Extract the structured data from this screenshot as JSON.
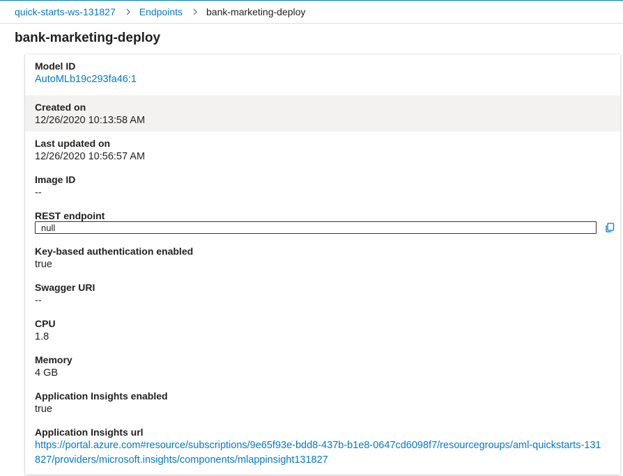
{
  "breadcrumb": {
    "items": [
      "quick-starts-ws-131827",
      "Endpoints"
    ],
    "current": "bank-marketing-deploy"
  },
  "page": {
    "title": "bank-marketing-deploy"
  },
  "details": {
    "model_id": {
      "label": "Model ID",
      "value": "AutoMLb19c293fa46:1"
    },
    "created_on": {
      "label": "Created on",
      "value": "12/26/2020 10:13:58 AM"
    },
    "last_updated": {
      "label": "Last updated on",
      "value": "12/26/2020 10:56:57 AM"
    },
    "image_id": {
      "label": "Image ID",
      "value": "--"
    },
    "rest_endpoint": {
      "label": "REST endpoint",
      "value": "null"
    },
    "key_auth": {
      "label": "Key-based authentication enabled",
      "value": "true"
    },
    "swagger_uri": {
      "label": "Swagger URI",
      "value": "--"
    },
    "cpu": {
      "label": "CPU",
      "value": "1.8"
    },
    "memory": {
      "label": "Memory",
      "value": "4 GB"
    },
    "app_insights_enabled": {
      "label": "Application Insights enabled",
      "value": "true"
    },
    "app_insights_url": {
      "label": "Application Insights url",
      "value": "https://portal.azure.com#resource/subscriptions/9e65f93e-bdd8-437b-b1e8-0647cd6098f7/resourcegroups/aml-quickstarts-131827/providers/microsoft.insights/components/mlappinsight131827"
    }
  },
  "icons": {
    "copy": "copy-icon",
    "breadcrumb_separator": "chevron-right-icon"
  },
  "colors": {
    "link": "#0078d4",
    "highlight_row": "#f3f2f1",
    "text": "#201f1e"
  }
}
